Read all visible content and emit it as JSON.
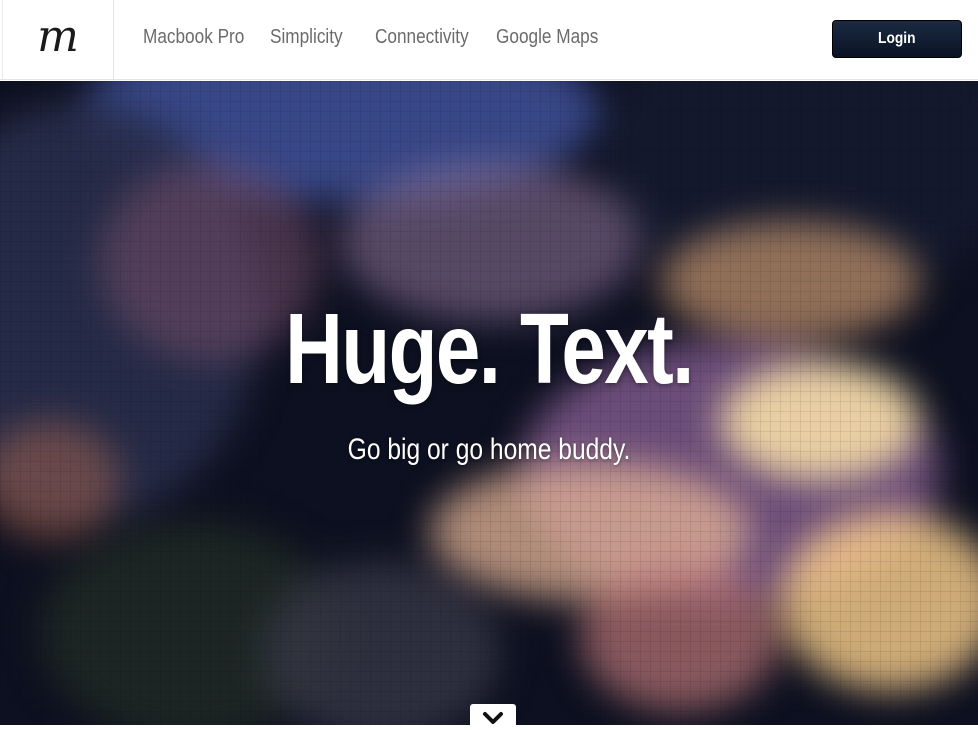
{
  "header": {
    "logo_text": "m",
    "nav": [
      "Macbook Pro",
      "Simplicity",
      "Connectivity",
      "Google Maps"
    ],
    "login_label": "Login"
  },
  "hero": {
    "title": "Huge. Text.",
    "subtitle": "Go big or go home buddy.",
    "scroll_icon": "chevron-down-icon"
  },
  "colors": {
    "nav_text": "#6b6b6b",
    "login_bg": "#0f1b30",
    "hero_text": "#ffffff"
  }
}
